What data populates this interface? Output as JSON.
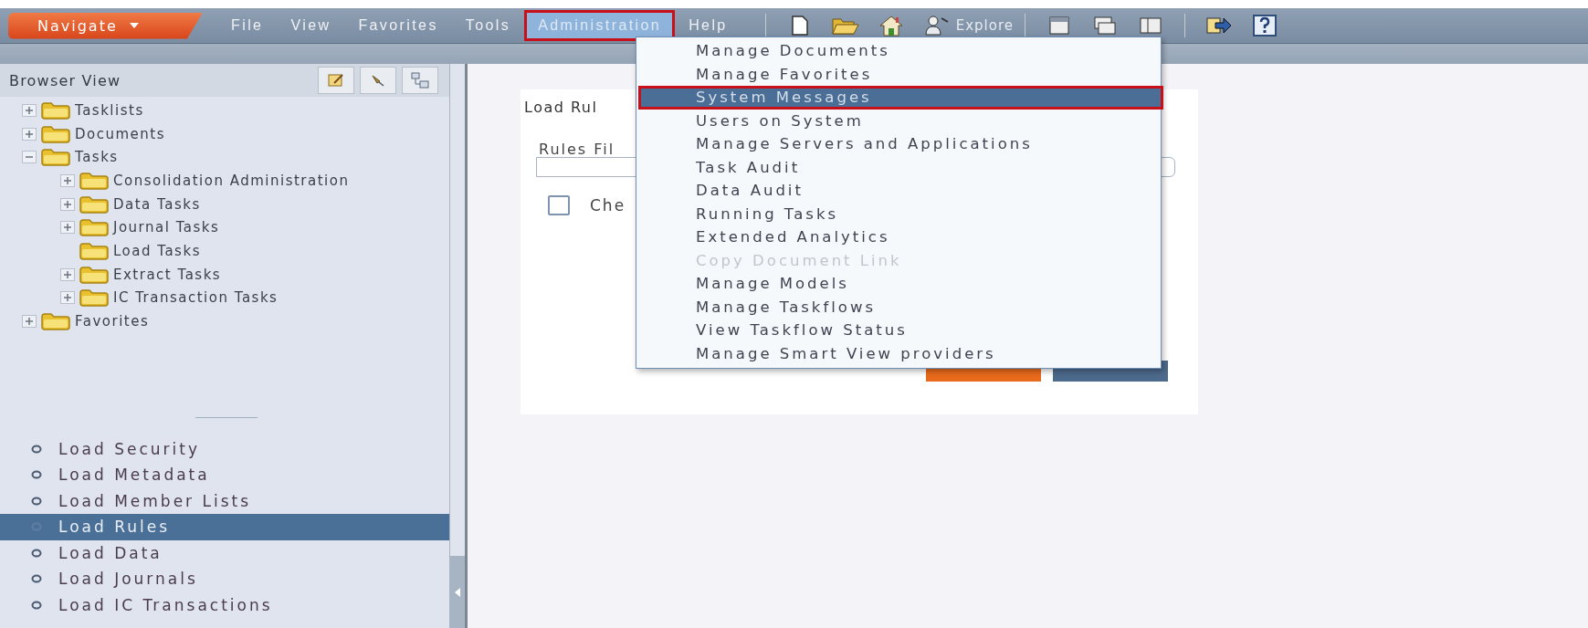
{
  "menu_bar": {
    "navigate": "Navigate",
    "items": [
      {
        "label": "File",
        "selected": false,
        "callout": false
      },
      {
        "label": "View",
        "selected": false,
        "callout": false
      },
      {
        "label": "Favorites",
        "selected": false,
        "callout": false
      },
      {
        "label": "Tools",
        "selected": false,
        "callout": false
      },
      {
        "label": "Administration",
        "selected": true,
        "callout": true
      },
      {
        "label": "Help",
        "selected": false,
        "callout": false
      }
    ],
    "explore": "Explore"
  },
  "browser_view": {
    "title": "Browser View",
    "tree": [
      {
        "label": "Tasklists",
        "expanded": false
      },
      {
        "label": "Documents",
        "expanded": false
      },
      {
        "label": "Tasks",
        "expanded": true,
        "children": [
          {
            "label": "Consolidation Administration",
            "expanded": false
          },
          {
            "label": "Data Tasks",
            "expanded": false
          },
          {
            "label": "Journal Tasks",
            "expanded": false
          },
          {
            "label": "Load Tasks"
          },
          {
            "label": "Extract Tasks",
            "expanded": false
          },
          {
            "label": "IC Transaction Tasks",
            "expanded": false
          }
        ]
      },
      {
        "label": "Favorites",
        "expanded": false
      }
    ]
  },
  "task_list": [
    {
      "label": "Load Security",
      "selected": false
    },
    {
      "label": "Load Metadata",
      "selected": false
    },
    {
      "label": "Load Member Lists",
      "selected": false
    },
    {
      "label": "Load Rules",
      "selected": true
    },
    {
      "label": "Load Data",
      "selected": false
    },
    {
      "label": "Load Journals",
      "selected": false
    },
    {
      "label": "Load IC Transactions",
      "selected": false
    }
  ],
  "panel": {
    "title": "Load Rul",
    "field_label": "Rules Fil",
    "checkbox": {
      "label": "Che",
      "checked": false
    },
    "buttons": [
      {
        "kind": "primary"
      },
      {
        "kind": "secondary"
      }
    ]
  },
  "admin_menu": [
    {
      "label": "Manage Documents",
      "selected": false,
      "disabled": false,
      "callout": false
    },
    {
      "label": "Manage Favorites",
      "selected": false,
      "disabled": false,
      "callout": false
    },
    {
      "label": "System Messages",
      "selected": true,
      "disabled": false,
      "callout": true
    },
    {
      "label": "Users on System",
      "selected": false,
      "disabled": false,
      "callout": false
    },
    {
      "label": "Manage Servers and Applications",
      "selected": false,
      "disabled": false,
      "callout": false
    },
    {
      "label": "Task Audit",
      "selected": false,
      "disabled": false,
      "callout": false
    },
    {
      "label": "Data Audit",
      "selected": false,
      "disabled": false,
      "callout": false
    },
    {
      "label": "Running Tasks",
      "selected": false,
      "disabled": false,
      "callout": false
    },
    {
      "label": "Extended Analytics",
      "selected": false,
      "disabled": false,
      "callout": false
    },
    {
      "label": "Copy Document Link",
      "selected": false,
      "disabled": true,
      "callout": false
    },
    {
      "label": "Manage Models",
      "selected": false,
      "disabled": false,
      "callout": false
    },
    {
      "label": "Manage Taskflows",
      "selected": false,
      "disabled": false,
      "callout": false
    },
    {
      "label": "View Taskflow Status",
      "selected": false,
      "disabled": false,
      "callout": false
    },
    {
      "label": "Manage Smart View providers",
      "selected": false,
      "disabled": false,
      "callout": false
    }
  ]
}
